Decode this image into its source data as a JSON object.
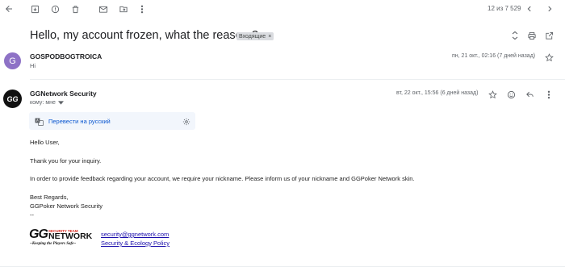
{
  "toolbar": {
    "page_count": "12 из 7 529"
  },
  "email": {
    "subject": "Hello, my account frozen, what the reason ?",
    "label": "Входящие",
    "label_remove": "×"
  },
  "message1": {
    "avatar_letter": "G",
    "sender": "GOSPODBOGTROICA",
    "snippet": "Hi",
    "date": "пн, 21 окт., 02:16 (7 дней назад)"
  },
  "message2": {
    "avatar_text": "GG",
    "sender": "GGNetwork Security",
    "to_line": "кому: мне",
    "date": "вт, 22 окт., 15:56 (6 дней назад)",
    "translate_label": "Перевести на русский",
    "body": {
      "greeting": "Hello User,",
      "thanks": "Thank you for your inquiry.",
      "request": "In order to provide feedback regarding your account, we require your nickname. Please inform us of your nickname and GGPoker Network skin.",
      "closing": "Best Regards,",
      "signature_name": "GGPoker Network Security",
      "separator": "--"
    },
    "signature": {
      "logo_team": "SECURITY TEAM",
      "logo_gg": "GG",
      "logo_network": "NETWORK",
      "logo_tagline": "~Keeping the Players Safe~",
      "email_link": "security@ggnetwork.com",
      "policy_link": "Security & Ecology Policy"
    }
  },
  "colors": {
    "avatar_purple": "#8e72c6",
    "link_blue": "#0b57d0",
    "translate_bg": "#f2f6fc",
    "logo_red": "#d9241b"
  }
}
